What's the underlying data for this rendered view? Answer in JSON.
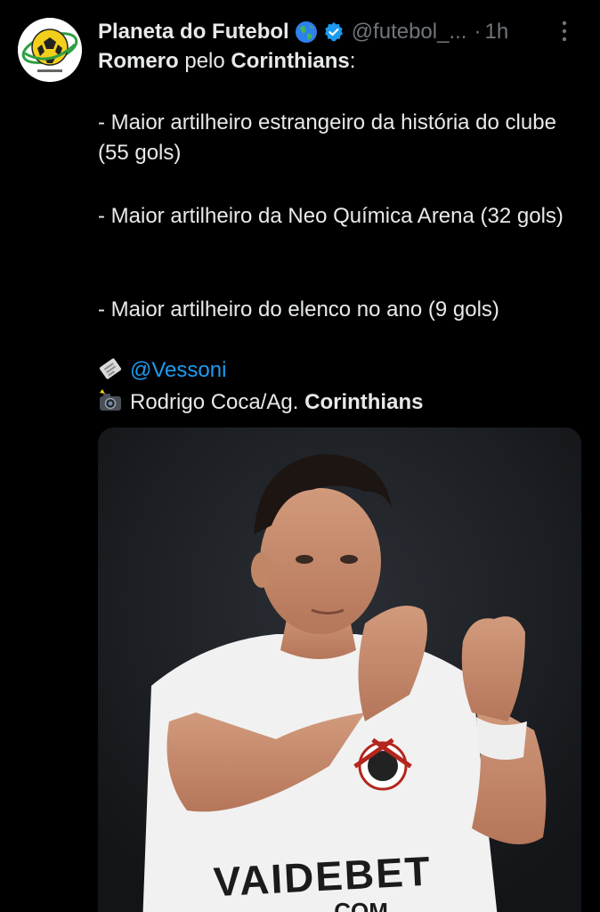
{
  "tweet": {
    "display_name": "Planeta do Futebol",
    "handle": "@futebol_...",
    "separator": "·",
    "time": "1h",
    "intro": {
      "name": "Romero",
      "middle": " pelo ",
      "club": "Corinthians",
      "end": ":"
    },
    "bullets": [
      "- Maior artilheiro estrangeiro da história do clube (55 gols)",
      "- Maior artilheiro da Neo Química Arena (32 gols)",
      "- Maior artilheiro do elenco no ano (9 gols)"
    ],
    "source_mention": "@Vessoni",
    "photo_credit_prefix": "Rodrigo Coca/Ag. ",
    "photo_credit_club": "Corinthians",
    "jersey_sponsor": "VAIDEBET",
    "jersey_sponsor_suffix": ".COM"
  },
  "colors": {
    "background": "#000000",
    "text": "#e7e9ea",
    "secondary": "#71767b",
    "link": "#1d9bf0",
    "verified": "#1d9bf0"
  },
  "icons": {
    "avatar": "planeta-do-futebol-logo",
    "globe": "globe-icon",
    "verified": "verified-badge-icon",
    "more": "more-vertical-icon",
    "source": "newspaper-icon",
    "camera": "camera-flash-icon"
  }
}
